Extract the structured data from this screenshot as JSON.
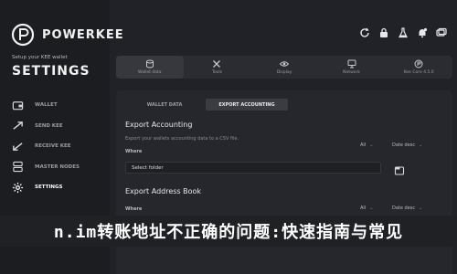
{
  "brand": {
    "name": "POWERKEE"
  },
  "sidebar": {
    "setup_label": "Setup your KEE wallet",
    "title": "SETTINGS",
    "items": [
      {
        "label": "WALLET",
        "icon": "wallet-icon"
      },
      {
        "label": "SEND KEE",
        "icon": "send-icon"
      },
      {
        "label": "RECEIVE KEE",
        "icon": "receive-icon"
      },
      {
        "label": "MASTER NODES",
        "icon": "masternodes-icon"
      },
      {
        "label": "SETTINGS",
        "icon": "gear-icon",
        "active": true
      }
    ]
  },
  "topbar": {
    "icons": [
      "refresh-icon",
      "lock-icon",
      "flask-icon",
      "notification-icon",
      "cards-icon"
    ]
  },
  "tabs": [
    {
      "label": "Wallet data",
      "icon": "database-icon"
    },
    {
      "label": "Tools",
      "icon": "tools-icon"
    },
    {
      "label": "Display",
      "icon": "eye-icon"
    },
    {
      "label": "Network",
      "icon": "network-icon"
    },
    {
      "label": "Kee Core 4.5.0",
      "icon": "kee-core-icon"
    }
  ],
  "subtabs": [
    {
      "label": "WALLET DATA"
    },
    {
      "label": "EXPORT ACCOUNTING",
      "active": true
    }
  ],
  "export_accounting": {
    "title": "Export Accounting",
    "desc": "Export your wallets accounting data to a CSV file.",
    "where_label": "Where",
    "filter_all": "All",
    "filter_date": "Date desc",
    "select_folder": "Select folder"
  },
  "export_address_book": {
    "title": "Export Address Book",
    "where_label": "Where",
    "filter_all": "All",
    "filter_date": "Date desc"
  },
  "overlay_text": "n.im转账地址不正确的问题:快速指南与常见"
}
